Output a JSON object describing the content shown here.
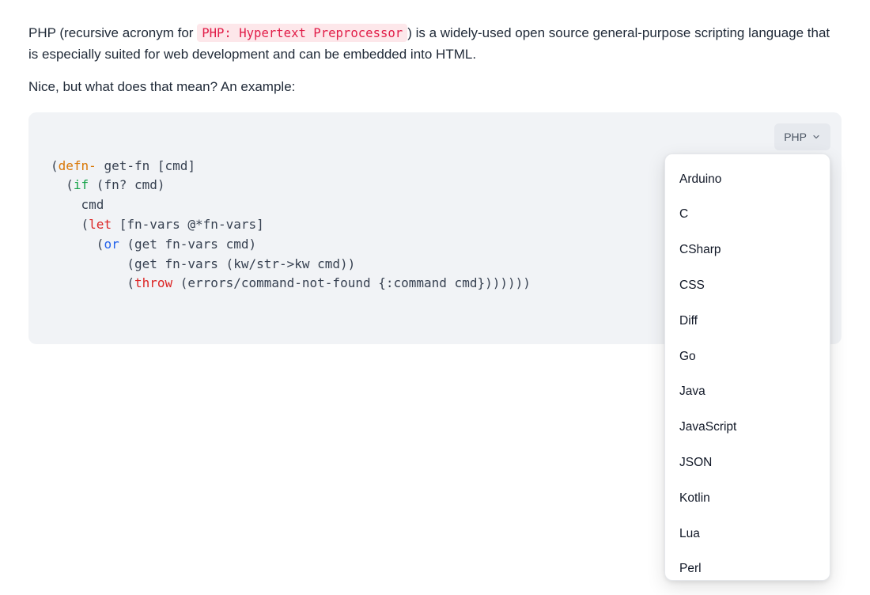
{
  "intro": {
    "p1_before": "PHP (recursive acronym for ",
    "p1_code": "PHP: Hypertext Preprocessor",
    "p1_after": ") is a widely-used open source general-purpose scripting language that is especially suited for web development and can be embedded into HTML.",
    "p2": "Nice, but what does that mean? An example:"
  },
  "code": {
    "language_label": "PHP",
    "tokens": {
      "defn": "defn-",
      "if": "if",
      "let": "let",
      "or": "or",
      "throw": "throw"
    },
    "lines_plain": [
      "(defn- get-fn [cmd]",
      "  (if (fn? cmd)",
      "    cmd",
      "    (let [fn-vars @*fn-vars]",
      "      (or (get fn-vars cmd)",
      "          (get fn-vars (kw/str->kw cmd))",
      "          (throw (errors/command-not-found {:command cmd}))))))"
    ]
  },
  "dropdown": {
    "items": [
      "Arduino",
      "C",
      "CSharp",
      "CSS",
      "Diff",
      "Go",
      "Java",
      "JavaScript",
      "JSON",
      "Kotlin",
      "Lua",
      "Perl"
    ]
  }
}
